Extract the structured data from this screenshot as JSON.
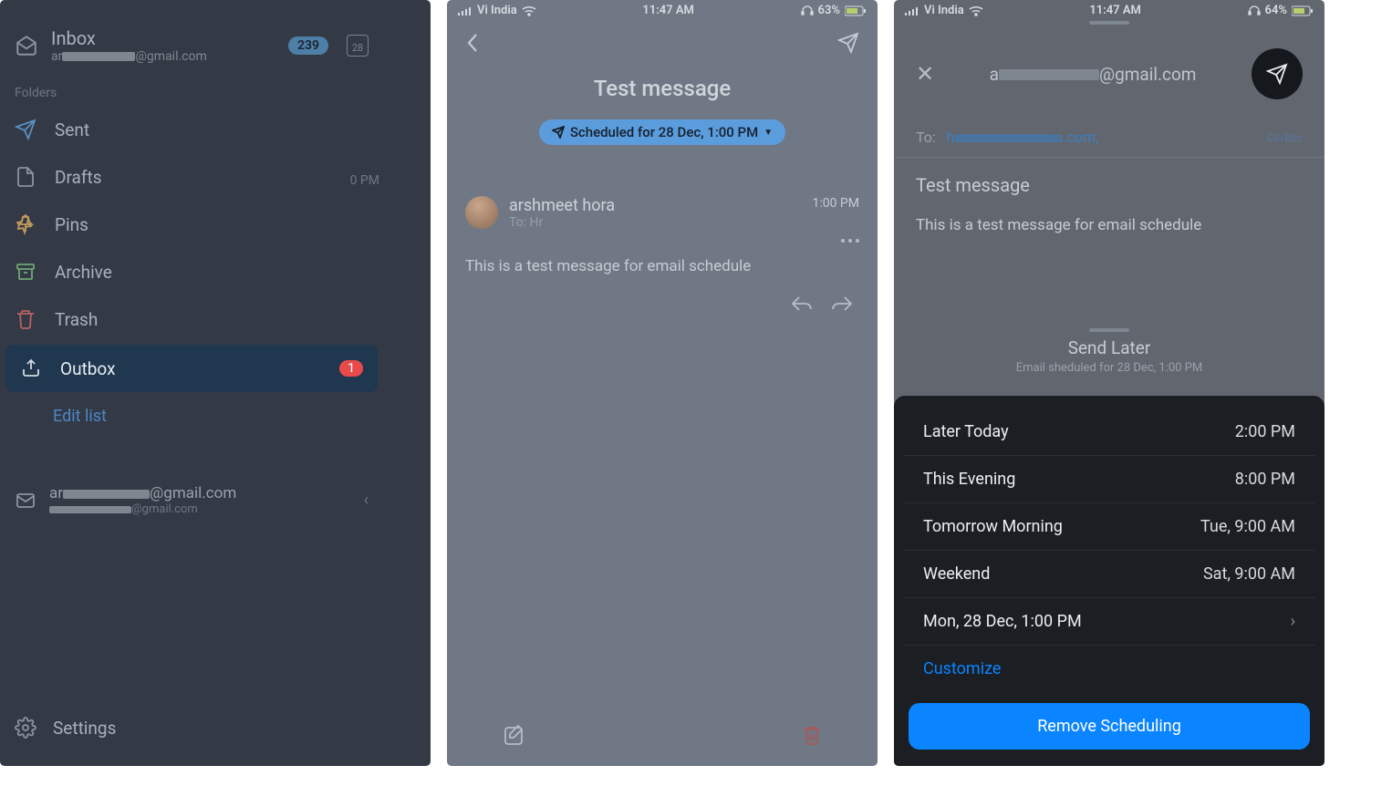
{
  "screen1": {
    "inbox": {
      "title": "Inbox",
      "email_prefix": "ar",
      "email_suffix": "@gmail.com",
      "count": "239",
      "cal_day": "28"
    },
    "folders_label": "Folders",
    "folders": {
      "sent": "Sent",
      "drafts": "Drafts",
      "pins": "Pins",
      "archive": "Archive",
      "trash": "Trash",
      "outbox": "Outbox",
      "outbox_count": "1"
    },
    "edit_list": "Edit list",
    "account": {
      "title_prefix": "ar",
      "title_suffix": "@gmail.com",
      "sub_suffix": "@gmail.com"
    },
    "settings": "Settings",
    "peek_time": "0 PM"
  },
  "screen2": {
    "status": {
      "carrier": "Vi India",
      "time": "11:47 AM",
      "battery": "63%"
    },
    "title": "Test message",
    "scheduled_pill": "Scheduled for 28 Dec, 1:00 PM",
    "sender": {
      "name": "arshmeet hora",
      "to": "To: Hr",
      "time": "1:00 PM"
    },
    "body": "This is a test message for email schedule"
  },
  "screen3": {
    "status": {
      "carrier": "Vi India",
      "time": "11:47 AM",
      "battery": "64%"
    },
    "from_prefix": "a",
    "from_suffix": "@gmail.com",
    "to_label": "To:",
    "to_suffix": "a.com,",
    "ccbcc": "Cc/Bcc",
    "subject": "Test message",
    "body": "This is a test message for email schedule",
    "send_later_title": "Send Later",
    "send_later_sub": "Email sheduled for 28 Dec, 1:00 PM",
    "options": [
      {
        "label": "Later Today",
        "value": "2:00 PM"
      },
      {
        "label": "This Evening",
        "value": "8:00 PM"
      },
      {
        "label": "Tomorrow Morning",
        "value": "Tue, 9:00 AM"
      },
      {
        "label": "Weekend",
        "value": "Sat, 9:00 AM"
      },
      {
        "label": "Mon, 28 Dec, 1:00 PM",
        "value": "›"
      }
    ],
    "customize": "Customize",
    "remove": "Remove Scheduling"
  }
}
